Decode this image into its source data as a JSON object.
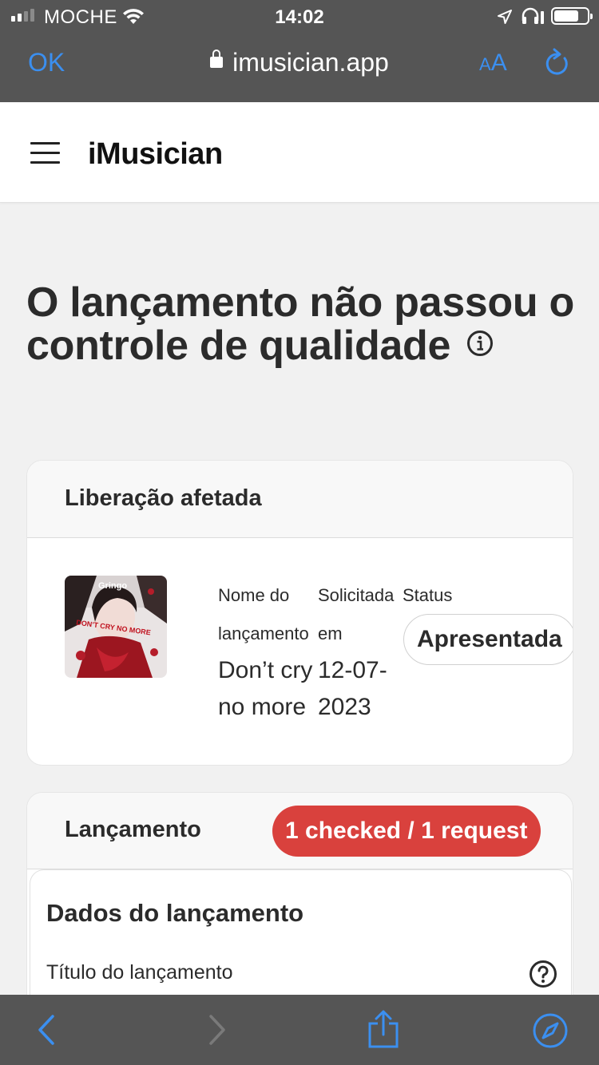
{
  "status_bar": {
    "carrier": "MOCHE",
    "time": "14:02",
    "signal_bars_active": 2,
    "signal_bars_total": 4,
    "battery_level": 0.7
  },
  "browser": {
    "ok_label": "OK",
    "url": "imusician.app",
    "text_size_label_small": "A",
    "text_size_label_large": "A",
    "accent_color": "#3b8ff0"
  },
  "site": {
    "brand": "iMusician"
  },
  "page": {
    "heading": "O lançamento não passou o controle de qualidade"
  },
  "affected_release": {
    "title": "Liberação afetada",
    "cover_text_top": "Gringo",
    "cover_text_mid": "DON'T CRY NO MORE",
    "columns": {
      "name_label": "Nome do lançamento",
      "requested_label": "Solicitada em",
      "status_label": "Status"
    },
    "release_name": "Don’t cry no more",
    "requested_date": "12-07-2023",
    "status": "Apresentada"
  },
  "release_section": {
    "title": "Lançamento",
    "badge": "1 checked / 1 request",
    "badge_color": "#d9413d",
    "subsection_title": "Dados do lançamento",
    "field_label": "Título do lançamento"
  }
}
